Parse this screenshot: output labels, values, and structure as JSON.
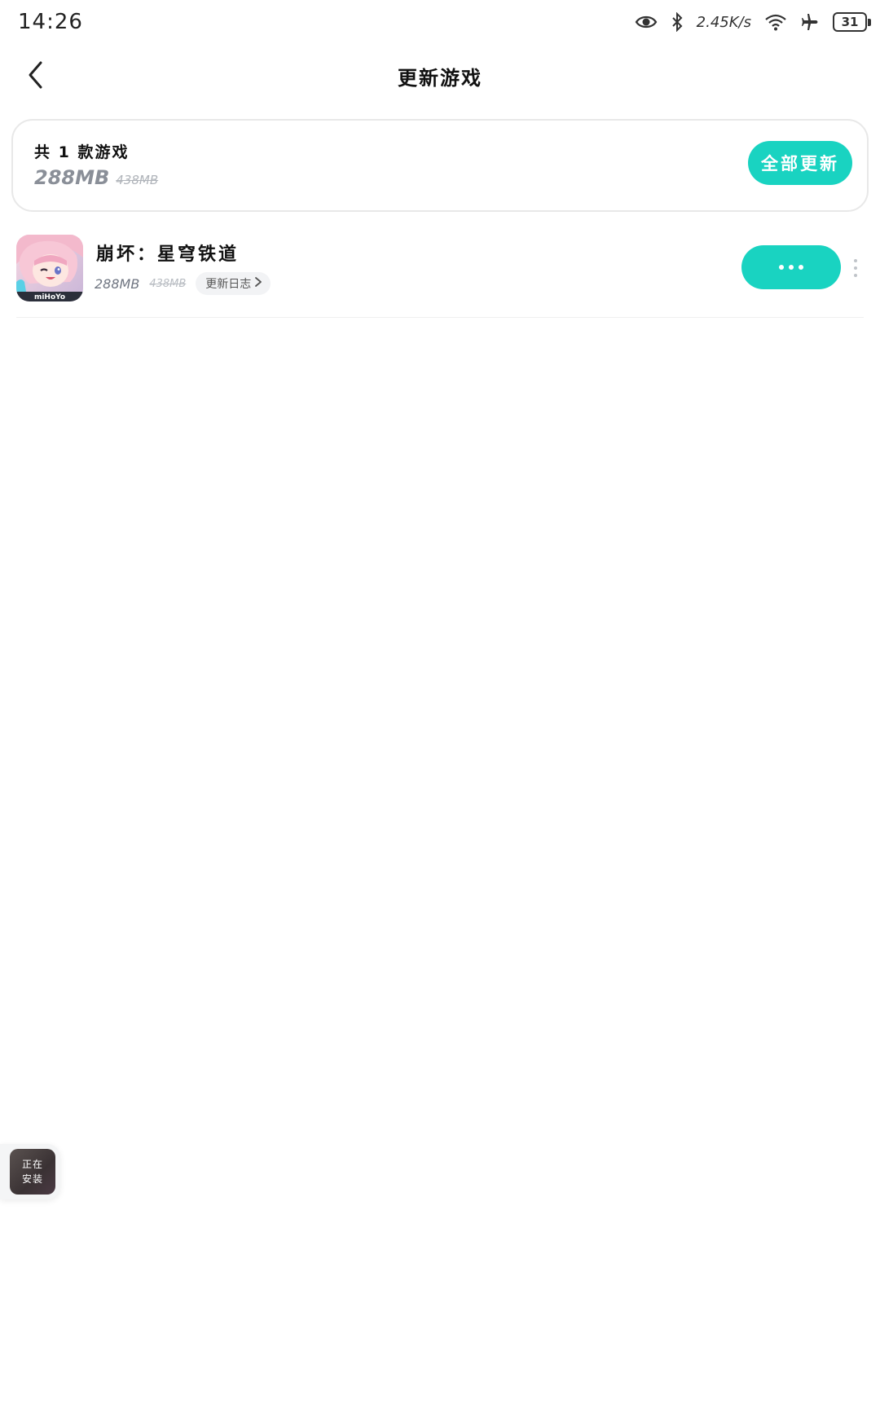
{
  "status_bar": {
    "time": "14:26",
    "net_speed": "2.45K/s",
    "battery": "31",
    "icons": [
      "eye-icon",
      "bluetooth-icon",
      "wifi-icon",
      "airplane-icon",
      "battery-icon"
    ]
  },
  "header": {
    "title": "更新游戏",
    "back_icon": "chevron-left-icon"
  },
  "summary": {
    "count_text": "共 1 款游戏",
    "size_new": "288MB",
    "size_old": "438MB",
    "update_all_label": "全部更新"
  },
  "games": [
    {
      "name": "崩坏：星穹铁道",
      "size_new": "288MB",
      "size_old": "438MB",
      "changelog_label": "更新日志",
      "icon_text": "miHoYo",
      "action_icon": "ellipsis-icon",
      "menu_icon": "more-vertical-icon"
    }
  ],
  "floating_widget": {
    "line1": "正在",
    "line2": "安装"
  },
  "colors": {
    "accent": "#19d3c1",
    "text_primary": "#111111",
    "text_secondary": "#8a8f98"
  }
}
